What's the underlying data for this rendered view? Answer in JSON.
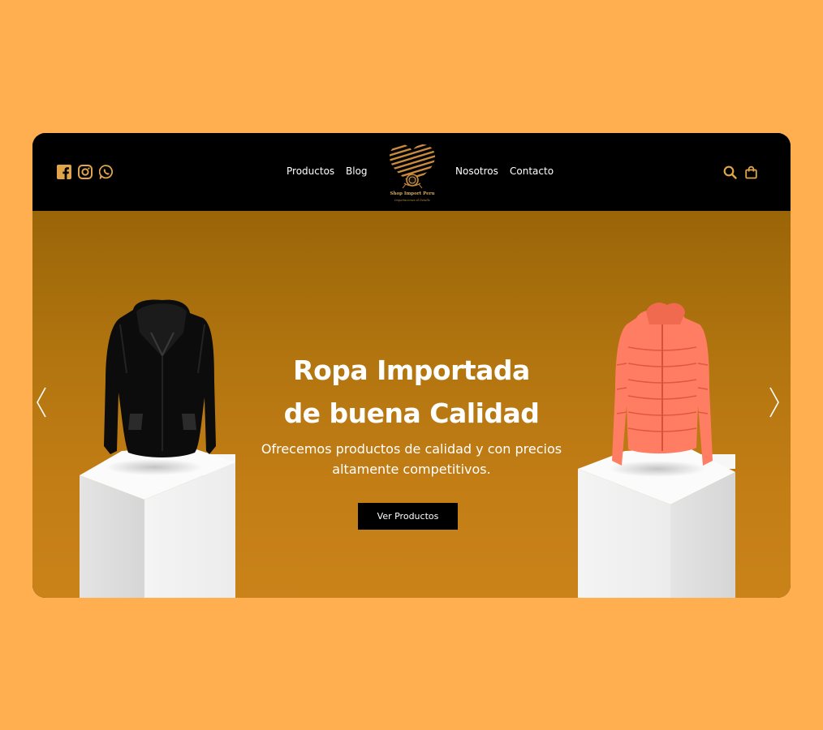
{
  "header": {
    "social": [
      {
        "icon": "facebook-icon"
      },
      {
        "icon": "instagram-icon"
      },
      {
        "icon": "whatsapp-icon"
      }
    ],
    "nav_left": [
      "Productos",
      "Blog"
    ],
    "nav_right": [
      "Nosotros",
      "Contacto"
    ],
    "logo": {
      "name": "Shop Import Peru",
      "tagline": "Importaciones al Detalle"
    },
    "actions": [
      {
        "icon": "search-icon"
      },
      {
        "icon": "shopping-bag-icon"
      }
    ]
  },
  "hero": {
    "title_line1": "Ropa Importada",
    "title_line2": "de buena Calidad",
    "subtitle": "Ofrecemos productos de calidad y con precios altamente competitivos.",
    "cta_label": "Ver Productos",
    "prev_icon": "chevron-left-icon",
    "next_icon": "chevron-right-icon"
  },
  "colors": {
    "page_background": "#FFAF4F",
    "header_background": "#000000",
    "accent_gold": "#E0A44A",
    "hero_gradient_top": "#9A6508",
    "hero_gradient_bottom": "#C98319",
    "cta_background": "#000000"
  }
}
